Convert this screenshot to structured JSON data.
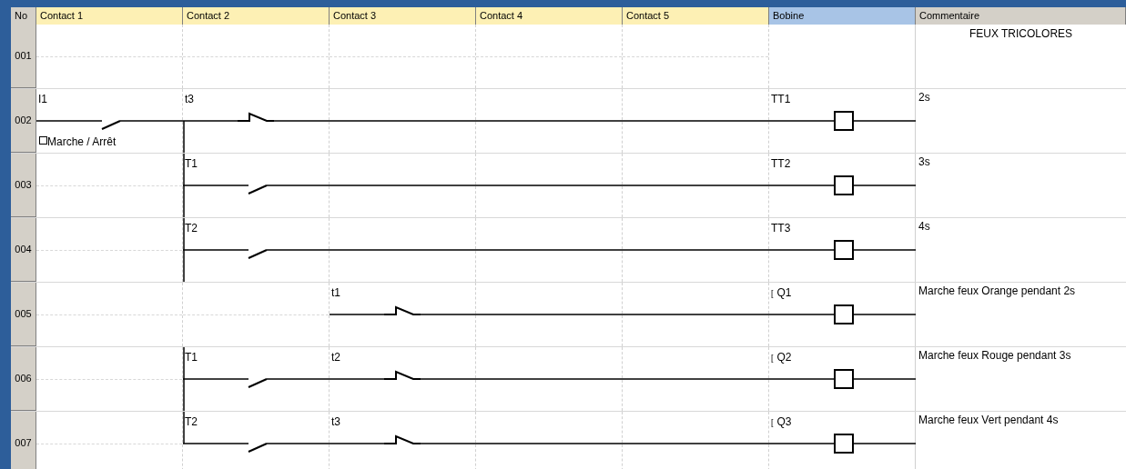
{
  "columns": [
    {
      "label": "No",
      "color": "#d4d0c8"
    },
    {
      "label": "Contact 1",
      "color": "#fdf0b4"
    },
    {
      "label": "Contact 2",
      "color": "#fdf0b4"
    },
    {
      "label": "Contact 3",
      "color": "#fdf0b4"
    },
    {
      "label": "Contact 4",
      "color": "#fdf0b4"
    },
    {
      "label": "Contact 5",
      "color": "#fdf0b4"
    },
    {
      "label": "Bobine",
      "color": "#a8c4e6"
    },
    {
      "label": "Commentaire",
      "color": "#d4d0c8"
    }
  ],
  "rows": [
    {
      "no": "001",
      "comment": {
        "kind": "title",
        "text": "FEUX TRICOLORES"
      }
    },
    {
      "no": "002",
      "contact_1": {
        "label": "I1",
        "kind": "no",
        "note": "Marche / Arrêt"
      },
      "contact_2": {
        "label": "t3",
        "kind": "nc"
      },
      "coil": {
        "label": "TT1"
      },
      "comment": {
        "kind": "note",
        "text": "2s"
      }
    },
    {
      "no": "003",
      "contact_2": {
        "label": "T1",
        "kind": "no"
      },
      "coil": {
        "label": "TT2"
      },
      "comment": {
        "kind": "note",
        "text": "3s"
      }
    },
    {
      "no": "004",
      "contact_2": {
        "label": "T2",
        "kind": "no"
      },
      "coil": {
        "label": "TT3"
      },
      "comment": {
        "kind": "note",
        "text": "4s"
      }
    },
    {
      "no": "005",
      "contact_3": {
        "label": "t1",
        "kind": "nc"
      },
      "coil": {
        "marker": "[",
        "label": "Q1"
      },
      "comment": {
        "kind": "note",
        "text": "Marche feux Orange pendant 2s"
      }
    },
    {
      "no": "006",
      "contact_2": {
        "label": "T1",
        "kind": "no"
      },
      "contact_3": {
        "label": "t2",
        "kind": "nc"
      },
      "coil": {
        "marker": "[",
        "label": "Q2"
      },
      "comment": {
        "kind": "note",
        "text": "Marche feux Rouge pendant 3s"
      }
    },
    {
      "no": "007",
      "contact_2": {
        "label": "T2",
        "kind": "no"
      },
      "contact_3": {
        "label": "t3",
        "kind": "nc"
      },
      "coil": {
        "marker": "[",
        "label": "Q3"
      },
      "comment": {
        "kind": "note",
        "text": "Marche feux Vert pendant 4s"
      }
    }
  ]
}
